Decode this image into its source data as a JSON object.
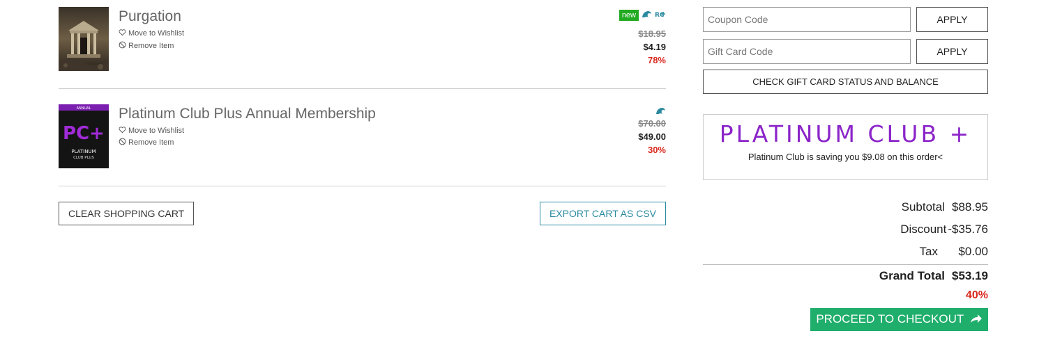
{
  "cart": {
    "items": [
      {
        "title": "Purgation",
        "wishlist_label": "Move to Wishlist",
        "remove_label": "Remove Item",
        "badge_new": "new",
        "icons": [
          "dolphin-icon",
          "rc-plus-icon"
        ],
        "old_price": "$18.95",
        "price": "$4.19",
        "discount_pct": "78%"
      },
      {
        "title": "Platinum Club Plus Annual Membership",
        "wishlist_label": "Move to Wishlist",
        "remove_label": "Remove Item",
        "thumb_top_text": "ANNUAL",
        "thumb_logo_text": "PC+",
        "thumb_caption_1": "PLATINUM",
        "thumb_caption_2": "CLUB PLUS",
        "icons": [
          "dolphin-icon"
        ],
        "old_price": "$70.00",
        "price": "$49.00",
        "discount_pct": "30%"
      }
    ],
    "clear_label": "CLEAR SHOPPING CART",
    "export_label": "EXPORT CART AS CSV"
  },
  "sidebar": {
    "coupon_placeholder": "Coupon Code",
    "gift_placeholder": "Gift Card Code",
    "apply_label": "APPLY",
    "gift_status_label": "CHECK GIFT CARD STATUS AND BALANCE",
    "promo_logo": "PLATINUM CLUB +",
    "promo_text": "Platinum Club is saving you $9.08 on this order<",
    "totals": {
      "subtotal_label": "Subtotal",
      "subtotal": "$88.95",
      "discount_label": "Discount",
      "discount": "-$35.76",
      "tax_label": "Tax",
      "tax": "$0.00",
      "grand_label": "Grand Total",
      "grand": "$53.19",
      "grand_pct": "40%"
    },
    "checkout_label": "PROCEED TO CHECKOUT"
  },
  "colors": {
    "accent_teal": "#2a8aa0",
    "discount_red": "#d9281e",
    "checkout_green": "#1fae6b",
    "new_badge_green": "#22aa22",
    "platinum_purple": "#8b24c9"
  }
}
